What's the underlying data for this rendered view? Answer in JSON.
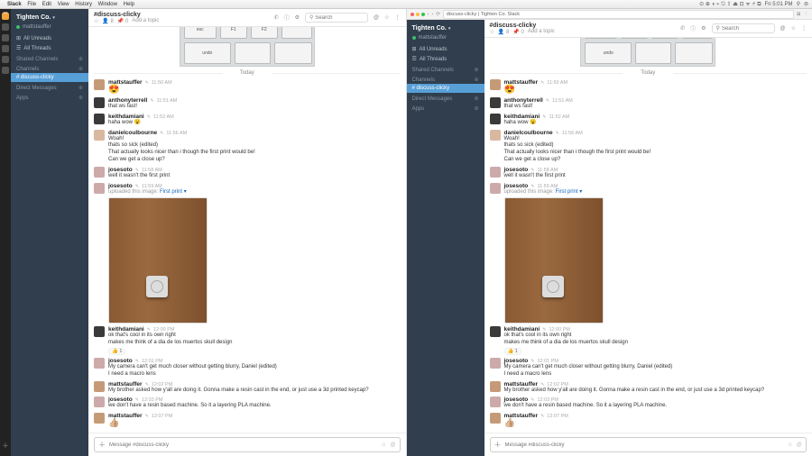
{
  "menubar": {
    "app": "Slack",
    "items": [
      "File",
      "Edit",
      "View",
      "History",
      "Window",
      "Help"
    ],
    "right": {
      "time": "Fri 5:01 PM"
    }
  },
  "chrome": {
    "tab_title": "discuss-clicky | Tighten Co. Slack",
    "url": ""
  },
  "workspace": {
    "name": "Tighten Co.",
    "user": "mattstauffer"
  },
  "sidebar": {
    "all_unreads": "All Unreads",
    "all_threads": "All Threads",
    "sec_shared": "Shared Channels",
    "sec_channels": "Channels",
    "sel_channel": "# discuss-clicky",
    "sec_dms": "Direct Messages",
    "sec_apps": "Apps"
  },
  "channel": {
    "name": "#discuss-clicky",
    "topic_prompt": "Add a topic",
    "search_ph": "Search",
    "date": "Today",
    "composer_ph_a": "Message #discuss-clicky",
    "composer_ph_b": "Message #discuss-clicky"
  },
  "messages": [
    {
      "user": "mattstauffer",
      "time": "11:50 AM",
      "av": "#c59b77",
      "lines": [],
      "emoji": "😍"
    },
    {
      "user": "anthonyterrell",
      "time": "11:51 AM",
      "av": "#3a3a3a",
      "lines": [
        "that ws fast!"
      ]
    },
    {
      "user": "keithdamiani",
      "time": "11:52 AM",
      "av": "#3a3a3a",
      "lines": [
        "haha wow 😮"
      ]
    },
    {
      "user": "danielcoulbourne",
      "time": "11:56 AM",
      "av": "#d9b8a0",
      "lines": [
        "Woah!",
        "thats so sick  (edited)",
        "That actually looks nicer than i though the first print would be!",
        "Can we get a close up?"
      ]
    },
    {
      "user": "josesoto",
      "time": "11:58 AM",
      "av": "#caa",
      "lines": [
        "well it wasn't the first print"
      ]
    },
    {
      "user": "josesoto",
      "time": "11:59 AM",
      "av": "#caa",
      "lines": [],
      "upload": "uploaded this image: ",
      "upload_name": "First print ▾",
      "photo": true
    },
    {
      "user": "keithdamiani",
      "time": "12:00 PM",
      "av": "#3a3a3a",
      "lines": [
        "ok that's cool in its own right",
        "makes me think of a dia de los muertos skull design"
      ],
      "react": "👍 1"
    },
    {
      "user": "josesoto",
      "time": "12:01 PM",
      "av": "#caa",
      "lines": [
        "My camera can't get much closer without getting blurry, Daniel  (edited)",
        "I need a macro lens"
      ]
    },
    {
      "user": "mattstauffer",
      "time": "12:02 PM",
      "av": "#c59b77",
      "lines": [
        "My brother asked how y'all are doing it. Gonna make a resin cast in the end, or just use a 3d printed keycap?"
      ]
    },
    {
      "user": "josesoto",
      "time": "12:03 PM",
      "av": "#caa",
      "lines": [
        "we don't have a resin based machine. So it a layering PLA machine."
      ]
    },
    {
      "user": "mattstauffer",
      "time": "12:07 PM",
      "av": "#c59b77",
      "lines": [],
      "emoji": "👍🏼"
    }
  ]
}
